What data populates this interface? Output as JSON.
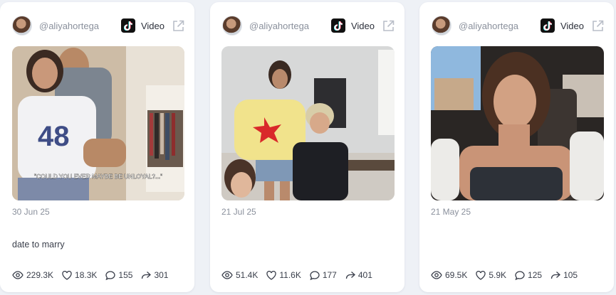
{
  "posts": [
    {
      "handle": "@aliyahortega",
      "platform_icon": "tiktok-icon",
      "type_label": "Video",
      "date": "30 Jun 25",
      "caption": "date to marry",
      "overlay_text": "\"COULD YOU EVER MAYBE BE UNLOYAL?...\"",
      "stats": {
        "views": "229.3K",
        "likes": "18.3K",
        "comments": "155",
        "shares": "301"
      }
    },
    {
      "handle": "@aliyahortega",
      "platform_icon": "tiktok-icon",
      "type_label": "Video",
      "date": "21 Jul 25",
      "caption": "",
      "stats": {
        "views": "51.4K",
        "likes": "11.6K",
        "comments": "177",
        "shares": "401"
      }
    },
    {
      "handle": "@aliyahortega",
      "platform_icon": "tiktok-icon",
      "type_label": "Video",
      "date": "21 May 25",
      "caption": "",
      "stats": {
        "views": "69.5K",
        "likes": "5.9K",
        "comments": "125",
        "shares": "105"
      }
    }
  ]
}
